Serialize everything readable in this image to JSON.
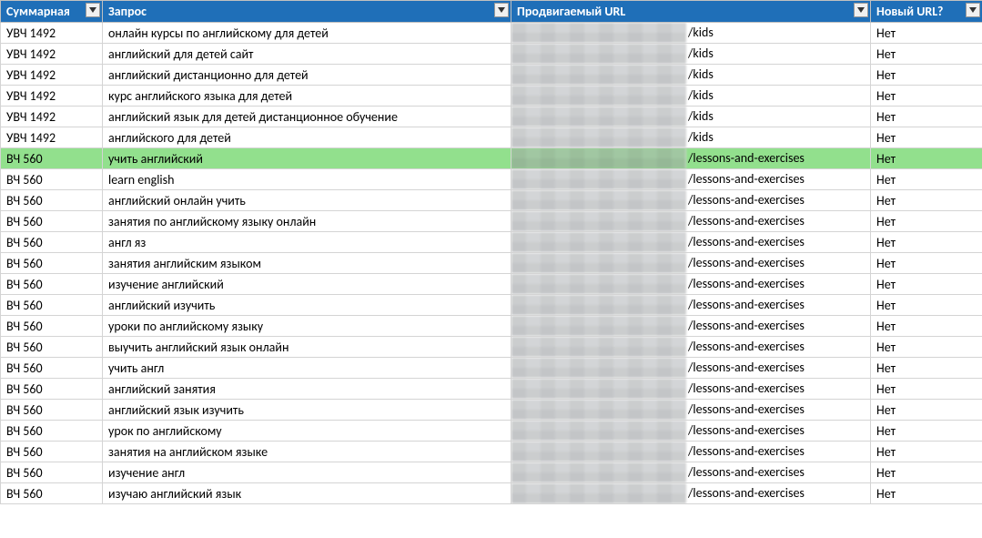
{
  "headers": {
    "summary": "Суммарная",
    "query": "Запрос",
    "url": "Продвигаемый URL",
    "new_url": "Новый URL?"
  },
  "rows": [
    {
      "summary": "УВЧ 1492",
      "query": "онлайн курсы по английскому для детей",
      "url": "/kids",
      "new_url": "Нет",
      "highlighted": false
    },
    {
      "summary": "УВЧ 1492",
      "query": "английский для детей сайт",
      "url": "/kids",
      "new_url": "Нет",
      "highlighted": false
    },
    {
      "summary": "УВЧ 1492",
      "query": "английский дистанционно для детей",
      "url": "/kids",
      "new_url": "Нет",
      "highlighted": false
    },
    {
      "summary": "УВЧ 1492",
      "query": "курс английского языка для детей",
      "url": "/kids",
      "new_url": "Нет",
      "highlighted": false
    },
    {
      "summary": "УВЧ 1492",
      "query": "английский язык для детей дистанционное обучение",
      "url": "/kids",
      "new_url": "Нет",
      "highlighted": false
    },
    {
      "summary": "УВЧ 1492",
      "query": "английского для детей",
      "url": "/kids",
      "new_url": "Нет",
      "highlighted": false
    },
    {
      "summary": "ВЧ 560",
      "query": "учить английский",
      "url": "/lessons-and-exercises",
      "new_url": "Нет",
      "highlighted": true
    },
    {
      "summary": "ВЧ 560",
      "query": "learn english",
      "url": "/lessons-and-exercises",
      "new_url": "Нет",
      "highlighted": false
    },
    {
      "summary": "ВЧ 560",
      "query": "английский онлайн учить",
      "url": "/lessons-and-exercises",
      "new_url": "Нет",
      "highlighted": false
    },
    {
      "summary": "ВЧ 560",
      "query": "занятия по английскому языку онлайн",
      "url": "/lessons-and-exercises",
      "new_url": "Нет",
      "highlighted": false
    },
    {
      "summary": "ВЧ 560",
      "query": "англ яз",
      "url": "/lessons-and-exercises",
      "new_url": "Нет",
      "highlighted": false
    },
    {
      "summary": "ВЧ 560",
      "query": "занятия английским языком",
      "url": "/lessons-and-exercises",
      "new_url": "Нет",
      "highlighted": false
    },
    {
      "summary": "ВЧ 560",
      "query": "изучение английский",
      "url": "/lessons-and-exercises",
      "new_url": "Нет",
      "highlighted": false
    },
    {
      "summary": "ВЧ 560",
      "query": "английский изучить",
      "url": "/lessons-and-exercises",
      "new_url": "Нет",
      "highlighted": false
    },
    {
      "summary": "ВЧ 560",
      "query": "уроки по английскому языку",
      "url": "/lessons-and-exercises",
      "new_url": "Нет",
      "highlighted": false
    },
    {
      "summary": "ВЧ 560",
      "query": "выучить английский язык онлайн",
      "url": "/lessons-and-exercises",
      "new_url": "Нет",
      "highlighted": false
    },
    {
      "summary": "ВЧ 560",
      "query": "учить англ",
      "url": "/lessons-and-exercises",
      "new_url": "Нет",
      "highlighted": false
    },
    {
      "summary": "ВЧ 560",
      "query": "английский занятия",
      "url": "/lessons-and-exercises",
      "new_url": "Нет",
      "highlighted": false
    },
    {
      "summary": "ВЧ 560",
      "query": "английский язык изучить",
      "url": "/lessons-and-exercises",
      "new_url": "Нет",
      "highlighted": false
    },
    {
      "summary": "ВЧ 560",
      "query": "урок по английскому",
      "url": "/lessons-and-exercises",
      "new_url": "Нет",
      "highlighted": false
    },
    {
      "summary": "ВЧ 560",
      "query": "занятия на английском языке",
      "url": "/lessons-and-exercises",
      "new_url": "Нет",
      "highlighted": false
    },
    {
      "summary": "ВЧ 560",
      "query": "изучение англ",
      "url": "/lessons-and-exercises",
      "new_url": "Нет",
      "highlighted": false
    },
    {
      "summary": "ВЧ 560",
      "query": "изучаю английский язык",
      "url": "/lessons-and-exercises",
      "new_url": "Нет",
      "highlighted": false
    }
  ]
}
